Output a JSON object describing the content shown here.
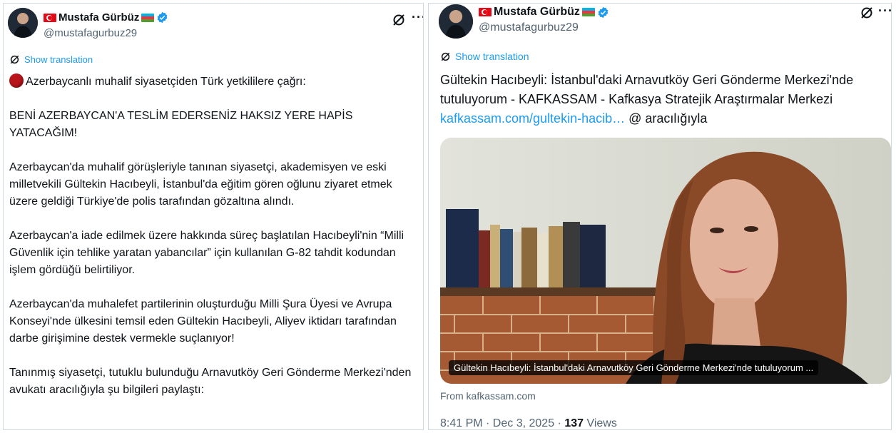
{
  "left_post": {
    "display_name": "Mustafa Gürbüz",
    "handle": "@mustafagurbuz29",
    "show_translation": "Show translation",
    "paragraphs": [
      "Azerbaycanlı muhalif siyasetçiden Türk yetkililere çağrı:",
      "BENİ AZERBAYCAN'A TESLİM EDERSENİZ HAKSIZ YERE HAPİS YATACAĞIM!",
      "Azerbaycan'da muhalif görüşleriyle tanınan siyasetçi, akademisyen ve eski milletvekili Gültekin Hacıbeyli, İstanbul'da eğitim gören oğlunu ziyaret etmek üzere geldiği Türkiye'de polis tarafından gözaltına alındı.",
      "Azerbaycan'a iade edilmek üzere hakkında süreç başlatılan Hacıbeyli'nin “Milli Güvenlik için tehlike yaratan yabancılar” için kullanılan G-82 tahdit kodundan işlem gördüğü belirtiliyor.",
      "Azerbaycan'da muhalefet partilerinin oluşturduğu Milli Şura Üyesi ve Avrupa Konseyi'nde ülkesini temsil eden Gültekin Hacıbeyli, Aliyev iktidarı tarafından darbe girişimine destek vermekle suçlanıyor!",
      "Tanınmış siyasetçi, tutuklu bulunduğu Arnavutköy Geri Gönderme Merkezi'nden avukatı aracılığıyla şu bilgileri paylaştı:"
    ]
  },
  "right_post": {
    "display_name": "Mustafa Gürbüz",
    "handle": "@mustafagurbuz29",
    "show_translation": "Show translation",
    "text": "Gültekin Hacıbeyli: İstanbul'daki Arnavutköy Geri Gönderme Merkezi'nde tutuluyorum - KAFKASSAM - Kafkasya Stratejik Araştırmalar Merkezi ",
    "link": "kafkassam.com/gultekin-hacib…",
    "link_suffix": " @ aracılığıyla",
    "card_caption": "Gültekin Hacıbeyli: İstanbul'daki Arnavutköy Geri Gönderme Merkezi'nde tutuluyorum ...",
    "card_source": "From kafkassam.com",
    "time": "8:41 PM · Dec 3, 2025 · ",
    "views_count": "137",
    "views_label": " Views"
  },
  "icons": {
    "flag_left": "turkey-flag-icon",
    "flag_right": "azerbaijan-flag-icon",
    "verified": "verified-badge-icon",
    "grok": "grok-icon",
    "more": "more-icon",
    "translate": "translate-icon",
    "red_circle": "red-circle-emoji"
  },
  "colors": {
    "link": "#1d9bf0",
    "secondary_text": "#536471",
    "primary_text": "#0f1419"
  }
}
